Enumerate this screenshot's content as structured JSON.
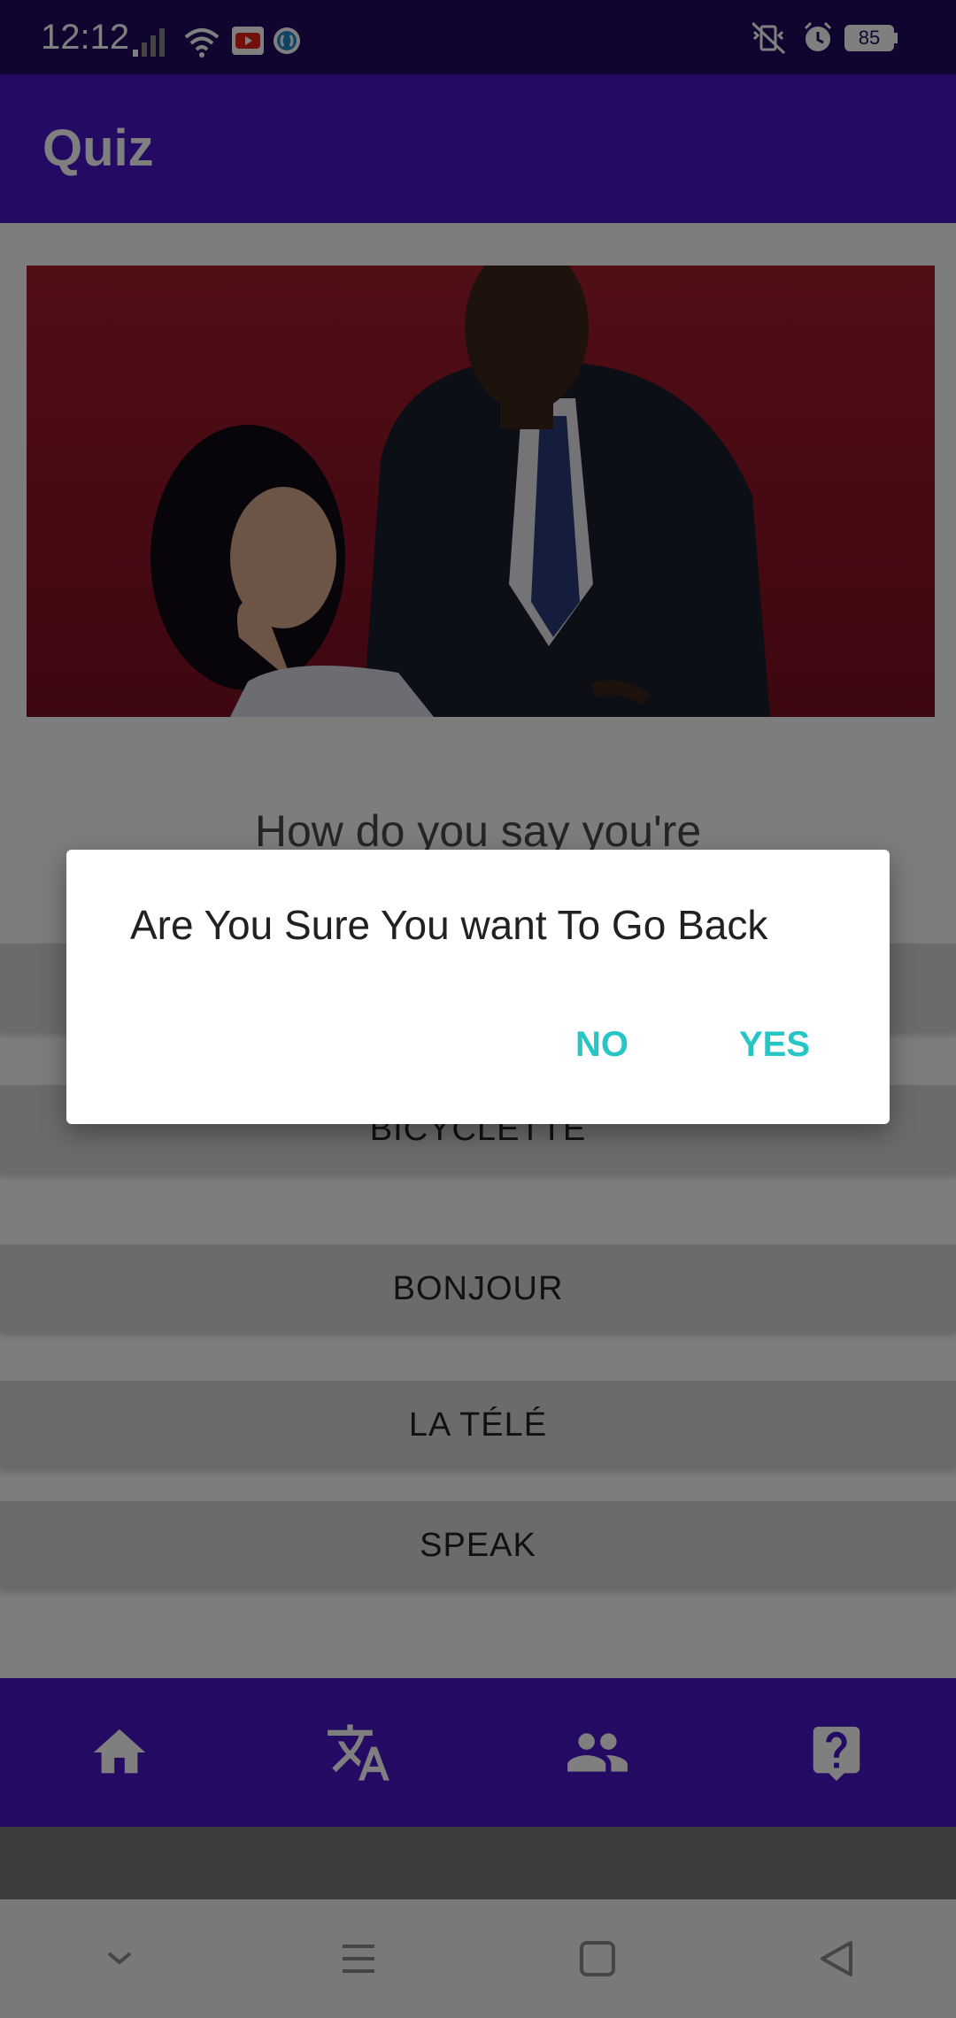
{
  "status_bar": {
    "time": "12:12",
    "battery": "85",
    "icons": [
      "signal-icon",
      "wifi-icon",
      "youtube-icon",
      "app-notification-icon",
      "vibrate-icon",
      "alarm-icon",
      "battery-icon"
    ]
  },
  "app_bar": {
    "title": "Quiz"
  },
  "quiz": {
    "question": "How do you say you're",
    "answers": [
      "",
      "BICYCLETTE",
      "BONJOUR",
      "LA TÉLÉ",
      "SPEAK"
    ]
  },
  "dialog": {
    "message": "Are You Sure You want To Go Back",
    "no_label": "NO",
    "yes_label": "YES",
    "accent_color": "#26c6c6"
  },
  "bottom_nav": {
    "items": [
      "home-icon",
      "translate-icon",
      "people-icon",
      "help-icon"
    ]
  },
  "system_nav": {
    "items": [
      "chevron-down-icon",
      "menu-icon",
      "square-icon",
      "back-icon"
    ]
  },
  "colors": {
    "primary": "#4a15c9",
    "status_bar": "#1e0b5c"
  }
}
